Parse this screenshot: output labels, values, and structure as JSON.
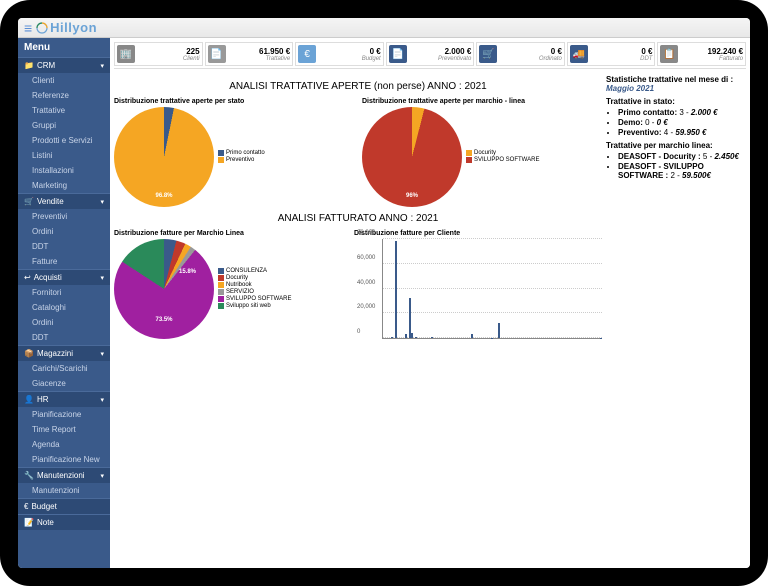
{
  "logo": "Hillyon",
  "menu": {
    "title": "Menu",
    "sections": [
      {
        "label": "CRM",
        "icon": "📁",
        "items": [
          "Clienti",
          "Referenze",
          "Trattative",
          "Gruppi",
          "Prodotti e Servizi",
          "Listini",
          "Installazioni",
          "Marketing"
        ]
      },
      {
        "label": "Vendite",
        "icon": "🛒",
        "items": [
          "Preventivi",
          "Ordini",
          "DDT",
          "Fatture"
        ]
      },
      {
        "label": "Acquisti",
        "icon": "↩",
        "items": [
          "Fornitori",
          "Cataloghi",
          "Ordini",
          "DDT"
        ]
      },
      {
        "label": "Magazzini",
        "icon": "📦",
        "items": [
          "Carichi/Scarichi",
          "Giacenze"
        ]
      },
      {
        "label": "HR",
        "icon": "👤",
        "items": [
          "Pianificazione",
          "Time Report",
          "Agenda",
          "Pianificazione New"
        ]
      },
      {
        "label": "Manutenzioni",
        "icon": "🔧",
        "items": [
          "Manutenzioni"
        ]
      },
      {
        "label": "Budget",
        "icon": "€",
        "items": []
      },
      {
        "label": "Note",
        "icon": "📝",
        "items": []
      }
    ]
  },
  "kpis": [
    {
      "icon": "building-icon",
      "glyph": "🏢",
      "value": "225",
      "label": "Clienti",
      "color": "#888"
    },
    {
      "icon": "file-icon",
      "glyph": "📄",
      "value": "61.950 €",
      "label": "Trattative",
      "color": "#999"
    },
    {
      "icon": "euro-icon",
      "glyph": "€",
      "value": "0 €",
      "label": "Budget",
      "color": "#6ba3d6"
    },
    {
      "icon": "doc-icon",
      "glyph": "📄",
      "value": "2.000 €",
      "label": "Preventivato",
      "color": "#3a5a8a"
    },
    {
      "icon": "cart-icon",
      "glyph": "🛒",
      "value": "0 €",
      "label": "Ordinato",
      "color": "#3a5a8a"
    },
    {
      "icon": "truck-icon",
      "glyph": "🚚",
      "value": "0 €",
      "label": "DDT",
      "color": "#3a5a8a"
    },
    {
      "icon": "clipboard-icon",
      "glyph": "📋",
      "value": "192.240 €",
      "label": "Fatturato",
      "color": "#888"
    }
  ],
  "section1_title": "ANALISI TRATTATIVE APERTE (non perse) ANNO : 2021",
  "section2_title": "ANALISI FATTURATO ANNO : 2021",
  "stats": {
    "title": "Statistiche trattative nel mese di :",
    "month": "Maggio 2021",
    "stato_title": "Trattative in stato:",
    "stato": [
      {
        "html": "<b>Primo contatto:</b> 3 - <b><i>2.000 €</i></b>"
      },
      {
        "html": "<b>Demo:</b> 0 - <b><i>0 €</i></b>"
      },
      {
        "html": "<b>Preventivo:</b> 4 - <b><i>59.950 €</i></b>"
      }
    ],
    "linea_title": "Trattative per marchio linea:",
    "linea": [
      {
        "html": "<b>DEASOFT - Docurity :</b> 5 - <b><i>2.450€</i></b>"
      },
      {
        "html": "<b>DEASOFT - SVILUPPO SOFTWARE :</b> 2 - <b><i>59.500€</i></b>"
      }
    ]
  },
  "chart_data": [
    {
      "type": "pie",
      "title": "Distribuzione trattative aperte per stato",
      "series": [
        {
          "name": "Primo contatto",
          "value": 3.2,
          "color": "#3a5a8a"
        },
        {
          "name": "Preventivo",
          "value": 96.8,
          "color": "#f5a623"
        }
      ],
      "labels": [
        "96.8%"
      ]
    },
    {
      "type": "pie",
      "title": "Distribuzione trattative aperte per marchio - linea",
      "series": [
        {
          "name": "Docurity",
          "value": 4,
          "color": "#f5a623"
        },
        {
          "name": "SVILUPPO SOFTWARE",
          "value": 96,
          "color": "#c0392b"
        }
      ],
      "labels": [
        "96%"
      ]
    },
    {
      "type": "pie",
      "title": "Distribuzione fatture per Marchio Linea",
      "series": [
        {
          "name": "CONSULENZA",
          "value": 4,
          "color": "#3a5a8a"
        },
        {
          "name": "Docurity",
          "value": 3,
          "color": "#c0392b"
        },
        {
          "name": "Nutribook",
          "value": 2,
          "color": "#f5a623"
        },
        {
          "name": "SERVIZIO",
          "value": 1.7,
          "color": "#999"
        },
        {
          "name": "SVILUPPO SOFTWARE",
          "value": 73.5,
          "color": "#a020a0"
        },
        {
          "name": "Sviluppo siti web",
          "value": 15.8,
          "color": "#2a8a5a"
        }
      ],
      "labels": [
        "73.5%",
        "15.8%"
      ]
    },
    {
      "type": "bar",
      "title": "Distribuzione fatture per Cliente",
      "ylim": [
        0,
        80000
      ],
      "yticks": [
        0,
        20000,
        40000,
        60000,
        80000
      ],
      "values": [
        0,
        0,
        0,
        0,
        500,
        0,
        78000,
        0,
        0,
        0,
        0,
        3000,
        0,
        32000,
        4000,
        0,
        500,
        0,
        0,
        0,
        0,
        0,
        0,
        0,
        1000,
        0,
        0,
        0,
        0,
        0,
        0,
        0,
        0,
        0,
        0,
        0,
        0,
        0,
        0,
        0,
        0,
        0,
        0,
        0,
        3000,
        0,
        0,
        0,
        0,
        0,
        0,
        0,
        0,
        0,
        300,
        0,
        0,
        12000,
        0,
        0,
        0,
        0,
        0,
        0,
        0,
        0,
        0,
        0,
        0,
        0,
        0,
        0,
        0,
        0,
        0,
        0,
        0,
        0,
        0,
        0,
        0,
        0,
        0,
        0,
        0,
        0,
        0,
        0,
        0,
        0,
        0,
        0,
        0,
        0,
        0,
        0,
        0,
        0,
        0,
        0,
        0,
        0,
        0,
        0,
        0,
        0,
        0,
        0,
        300
      ]
    }
  ]
}
